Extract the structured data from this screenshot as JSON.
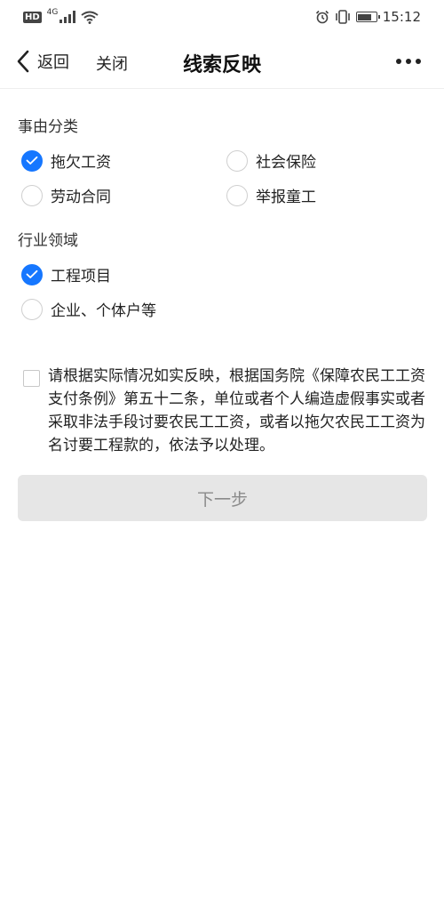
{
  "status_bar": {
    "hd": "HD",
    "network": "4G",
    "time": "15:12",
    "battery_level": 0.75
  },
  "nav": {
    "back_label": "返回",
    "close_label": "关闭",
    "title": "线索反映"
  },
  "sections": {
    "reason": {
      "title": "事由分类",
      "options": [
        {
          "label": "拖欠工资",
          "checked": true
        },
        {
          "label": "社会保险",
          "checked": false
        },
        {
          "label": "劳动合同",
          "checked": false
        },
        {
          "label": "举报童工",
          "checked": false
        }
      ]
    },
    "industry": {
      "title": "行业领域",
      "options": [
        {
          "label": "工程项目",
          "checked": true
        },
        {
          "label": "企业、个体户等",
          "checked": false
        }
      ]
    }
  },
  "agreement": {
    "checked": false,
    "text": "请根据实际情况如实反映，根据国务院《保障农民工工资支付条例》第五十二条，单位或者个人编造虚假事实或者采取非法手段讨要农民工工资，或者以拖欠农民工工资为名讨要工程款的，依法予以处理。"
  },
  "next_button": {
    "label": "下一步"
  },
  "colors": {
    "accent": "#1677ff",
    "button_disabled_bg": "#e6e6e6",
    "button_disabled_text": "#8a8a8a"
  },
  "icons": {
    "back": "chevron-left-icon",
    "more": "more-dots-icon",
    "checkmark": "checkmark-icon"
  }
}
